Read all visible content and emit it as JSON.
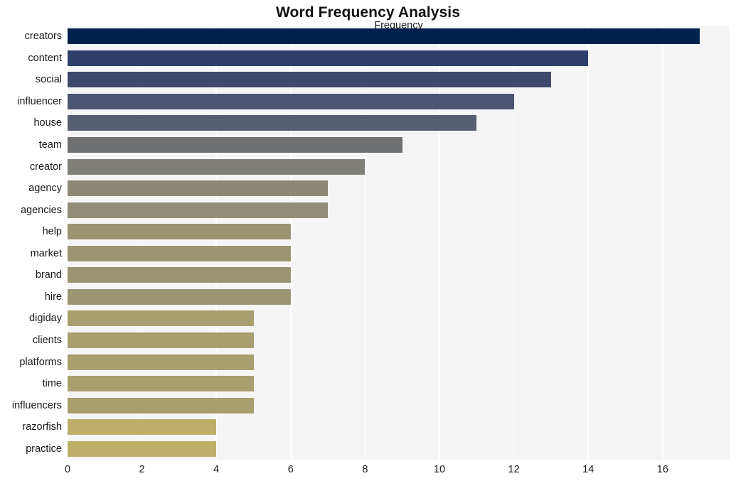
{
  "chart_data": {
    "type": "bar",
    "orientation": "horizontal",
    "title": "Word Frequency Analysis",
    "xlabel": "Frequency",
    "ylabel": "",
    "categories": [
      "creators",
      "content",
      "social",
      "influencer",
      "house",
      "team",
      "creator",
      "agency",
      "agencies",
      "help",
      "market",
      "brand",
      "hire",
      "digiday",
      "clients",
      "platforms",
      "time",
      "influencers",
      "razorfish",
      "practice"
    ],
    "values": [
      17,
      14,
      13,
      12,
      11,
      9,
      8,
      7,
      7,
      6,
      6,
      6,
      6,
      5,
      5,
      5,
      5,
      5,
      4,
      4
    ],
    "bar_colors": [
      "#00214d",
      "#2f3f6b",
      "#3e4a6d",
      "#4c5571",
      "#575e71",
      "#6e7071",
      "#7f7f77",
      "#8c8875",
      "#918d79",
      "#9b9572",
      "#9b9572",
      "#9b9572",
      "#9b9572",
      "#a89f6e",
      "#a89f6e",
      "#a89f6e",
      "#a89f6e",
      "#a89f6e",
      "#bdae67",
      "#bdae67"
    ],
    "xlim": [
      0,
      17.8
    ],
    "xticks": [
      0,
      2,
      4,
      6,
      8,
      10,
      12,
      14,
      16
    ],
    "xticklabels": [
      "0",
      "2",
      "4",
      "6",
      "8",
      "10",
      "12",
      "14",
      "16"
    ],
    "grid": true,
    "grid_axis": "x",
    "grid_color": "#ffffff",
    "plot_background": "#f5f5f5",
    "figure_background": "#ffffff",
    "legend": null,
    "colormap": "cividis"
  }
}
